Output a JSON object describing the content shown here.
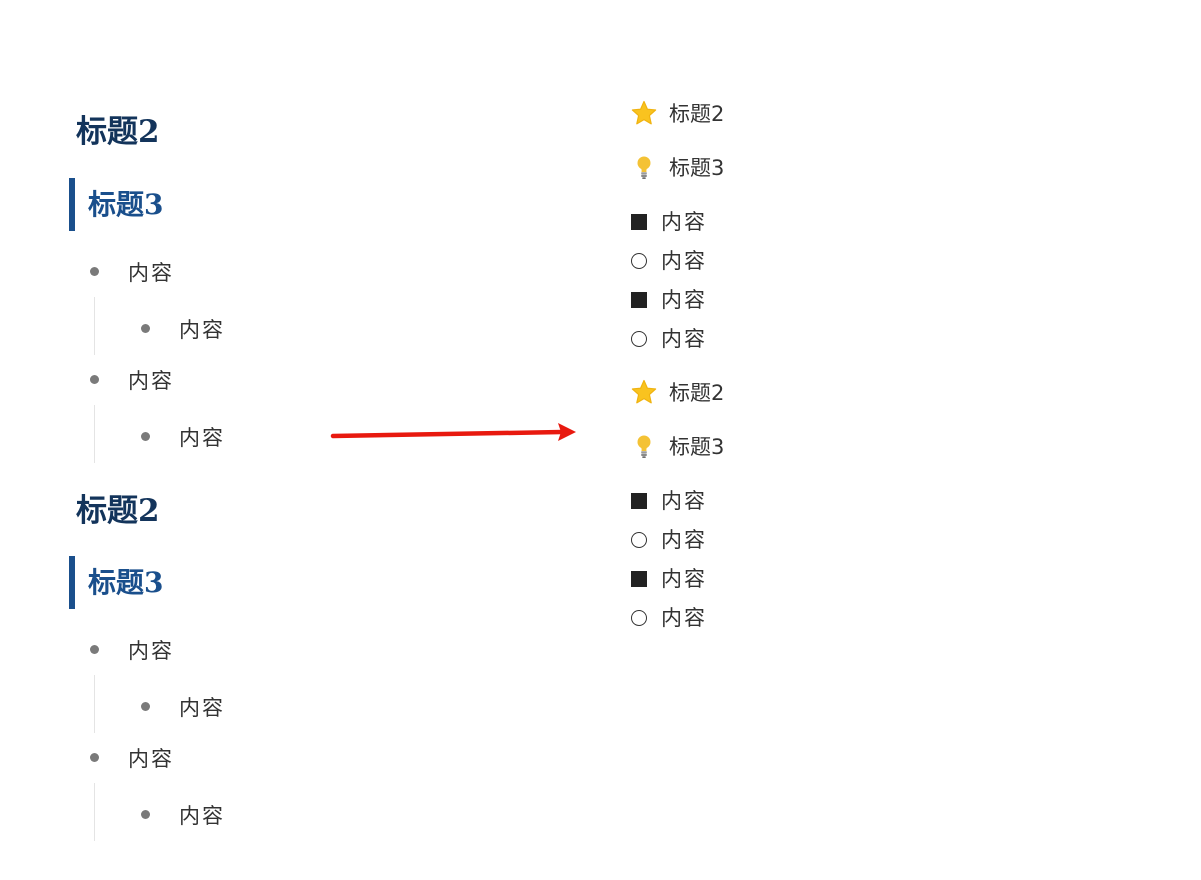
{
  "left": {
    "blocks": [
      {
        "h2": "标题2",
        "h3": "标题3",
        "items": [
          {
            "text": "内容",
            "child": "内容"
          },
          {
            "text": "内容",
            "child": "内容"
          }
        ]
      },
      {
        "h2": "标题2",
        "h3": "标题3",
        "items": [
          {
            "text": "内容",
            "child": "内容"
          },
          {
            "text": "内容",
            "child": "内容"
          }
        ]
      }
    ]
  },
  "right": {
    "blocks": [
      {
        "h2": {
          "icon": "star-icon",
          "text": "标题2"
        },
        "h3": {
          "icon": "lightbulb-icon",
          "text": "标题3"
        },
        "items": [
          {
            "marker": "filled-square",
            "text": "内容"
          },
          {
            "marker": "hollow-circle",
            "text": "内容"
          },
          {
            "marker": "filled-square",
            "text": "内容"
          },
          {
            "marker": "hollow-circle",
            "text": "内容"
          }
        ]
      },
      {
        "h2": {
          "icon": "star-icon",
          "text": "标题2"
        },
        "h3": {
          "icon": "lightbulb-icon",
          "text": "标题3"
        },
        "items": [
          {
            "marker": "filled-square",
            "text": "内容"
          },
          {
            "marker": "hollow-circle",
            "text": "内容"
          },
          {
            "marker": "filled-square",
            "text": "内容"
          },
          {
            "marker": "hollow-circle",
            "text": "内容"
          }
        ]
      }
    ]
  },
  "colors": {
    "h2": "#13345b",
    "h3": "#1a4f8c",
    "arrow": "#e8190f",
    "star": "#f9c31f",
    "bulb": "#f4c235"
  }
}
